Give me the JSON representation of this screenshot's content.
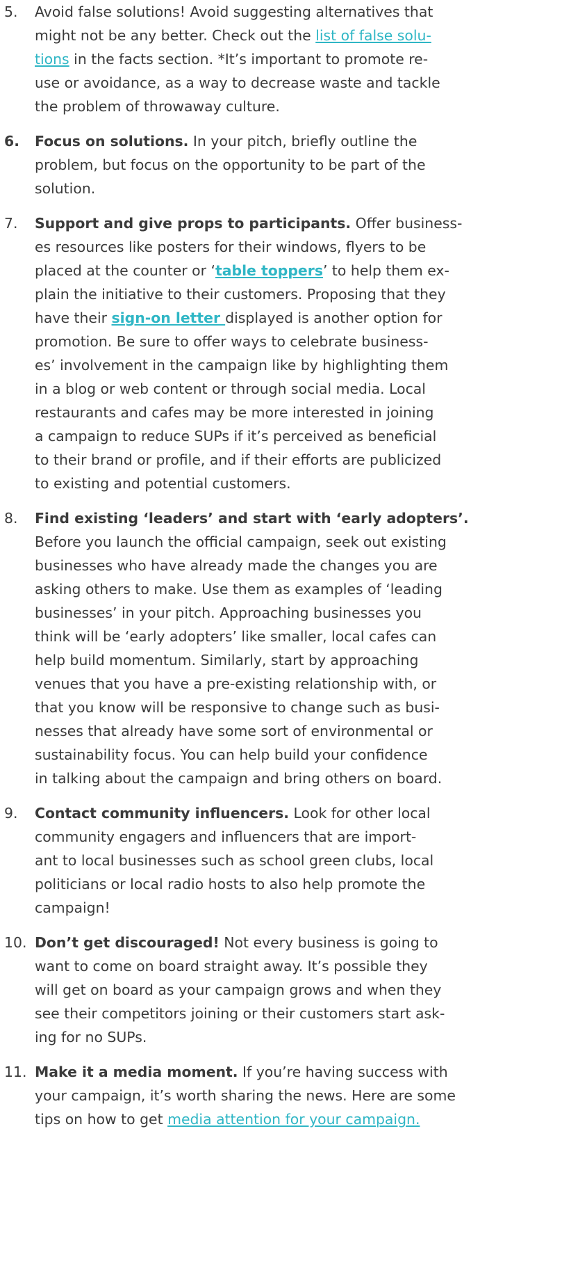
{
  "items": [
    {
      "number": "5.",
      "lines": [
        [
          "Avoid false solutions! Avoid suggesting alternatives that"
        ],
        [
          "might not be any better. Check out the ",
          {
            "link": "list of false solu-"
          }
        ],
        [
          {
            "link": "tions"
          },
          " in the facts section. *It’s  important  to promote re-"
        ],
        [
          "use or avoidance, as a way to decrease waste and tackle"
        ],
        [
          "the problem of throwaway culture."
        ]
      ]
    },
    {
      "number": "6.",
      "lines": [
        [
          {
            "lead": "Focus on solutions."
          },
          " In your pitch, briefly outline the"
        ],
        [
          "problem, but focus on the opportunity to be part of the"
        ],
        [
          "solution."
        ]
      ]
    },
    {
      "number": "7.",
      "lines": [
        [
          {
            "lead": "Support and give props to participants."
          },
          " Offer business-"
        ],
        [
          "es resources like posters for their windows, flyers to be"
        ],
        [
          "placed at the counter or ‘",
          {
            "boldlink": "table toppers"
          },
          "’ to help them ex-"
        ],
        [
          "plain the initiative to their customers. Proposing that they"
        ],
        [
          "have their ",
          {
            "boldlink": "sign-on letter "
          },
          "displayed is another option for"
        ],
        [
          "promotion. Be sure to offer ways to celebrate business-"
        ],
        [
          "es’ involvement in the campaign like by highlighting them"
        ],
        [
          "in a blog or web content or through social media. Local"
        ],
        [
          "restaurants and cafes may be more interested in joining"
        ],
        [
          "a campaign to reduce SUPs if it’s perceived as beneficial"
        ],
        [
          "to their brand or profile, and if their efforts are publicized"
        ],
        [
          "to existing and potential customers."
        ]
      ]
    },
    {
      "number": "8.",
      "lines": [
        [
          {
            "lead": "Find existing ‘leaders’ and start with ‘early adopters’."
          }
        ],
        [
          "Before you launch the official campaign, seek out existing"
        ],
        [
          "businesses who have already made the changes you are"
        ],
        [
          "asking others to make. Use them as examples of ‘leading"
        ],
        [
          "businesses’ in your pitch. Approaching businesses you"
        ],
        [
          "think will be ‘early adopters’ like smaller, local cafes can"
        ],
        [
          "help build momentum. Similarly, start by approaching"
        ],
        [
          "venues that you have a pre-existing relationship with, or"
        ],
        [
          "that you know will be responsive to change such as busi-"
        ],
        [
          "nesses that already have some sort of environmental or"
        ],
        [
          "sustainability focus. You can help build your confidence"
        ],
        [
          "in talking about the campaign and bring others on board."
        ]
      ]
    },
    {
      "number": "9.",
      "lines": [
        [
          {
            "lead": "Contact community influencers."
          },
          " Look for other local"
        ],
        [
          "community engagers and influencers that are import-"
        ],
        [
          "ant to local businesses such as school green clubs, local"
        ],
        [
          "politicians or local radio hosts to also help promote the"
        ],
        [
          "campaign!"
        ]
      ]
    },
    {
      "number": "10.",
      "lines": [
        [
          {
            "lead": "Don’t get discouraged!"
          },
          " Not every business is going to"
        ],
        [
          "want to come on board straight away. It’s possible they"
        ],
        [
          "will get on board as your campaign grows and when they"
        ],
        [
          "see their competitors joining or their customers start ask-"
        ],
        [
          "ing for no SUPs."
        ]
      ]
    },
    {
      "number": "11.",
      "lines": [
        [
          {
            "lead": "Make it a media moment."
          },
          " If you’re having success with"
        ],
        [
          "your campaign, it’s worth sharing the news. Here are some"
        ],
        [
          "tips on how to get ",
          {
            "link": "media attention for your campaign."
          }
        ]
      ]
    }
  ]
}
